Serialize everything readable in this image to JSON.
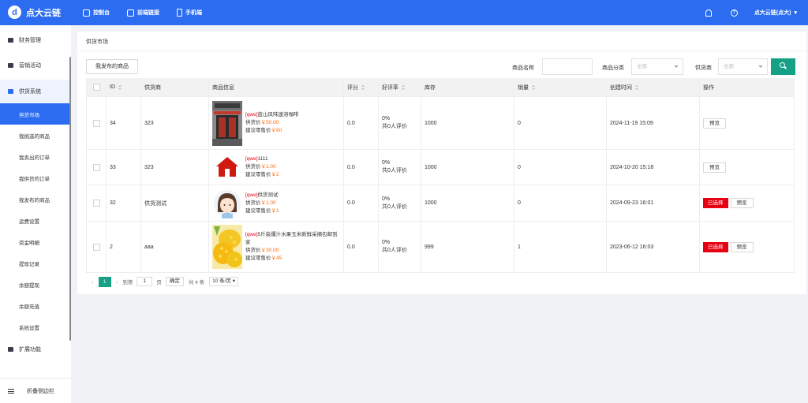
{
  "app": {
    "name": "点大云链",
    "logo_letter": "d"
  },
  "topnav": [
    {
      "label": "控制台",
      "icon": "dashboard-icon"
    },
    {
      "label": "前端链接",
      "icon": "edit-icon"
    },
    {
      "label": "手机端",
      "icon": "phone-icon"
    }
  ],
  "header": {
    "help_glyph": "?",
    "user": "点大云链(点大)",
    "caret": "▾"
  },
  "sidebar": {
    "items": [
      {
        "label": "财务管理",
        "type": "group"
      },
      {
        "label": "营销活动",
        "type": "group"
      },
      {
        "label": "供货系统",
        "type": "group"
      },
      {
        "label": "供货市场",
        "type": "sub"
      },
      {
        "label": "我挑选的商品",
        "type": "sub"
      },
      {
        "label": "我卖出的订单",
        "type": "sub"
      },
      {
        "label": "我供货的订单",
        "type": "sub"
      },
      {
        "label": "我发布的商品",
        "type": "sub"
      },
      {
        "label": "运费设置",
        "type": "sub"
      },
      {
        "label": "资金明细",
        "type": "sub"
      },
      {
        "label": "提现记录",
        "type": "sub"
      },
      {
        "label": "余额提现",
        "type": "sub"
      },
      {
        "label": "余额充值",
        "type": "sub"
      },
      {
        "label": "系统设置",
        "type": "sub"
      },
      {
        "label": "扩展功能",
        "type": "group"
      }
    ],
    "fold_label": "折叠侧边栏"
  },
  "page": {
    "title": "供货市场",
    "my_published_button": "我发布的商品",
    "filters": {
      "name_label": "商品名称",
      "name_value": "",
      "category_label": "商品分类",
      "category_value": "全部",
      "supplier_label": "供货商",
      "supplier_value": "全部"
    }
  },
  "table": {
    "headers": [
      "ID",
      "供货商",
      "商品信息",
      "评分",
      "好评率",
      "库存",
      "销量",
      "创建时间",
      "操作"
    ],
    "rows": [
      {
        "id": "34",
        "supplier": "323",
        "tag": "[qwe]",
        "name": "蓝山风味速溶咖啡",
        "supply_label": "供货价",
        "supply_price": "￥50.00",
        "retail_label": "建议零售价",
        "retail_price": "￥60",
        "score": "0.0",
        "rate": "0%",
        "reviews": "共0人评价",
        "stock": "1000",
        "sales": "0",
        "created": "2024-11-19 15:09",
        "selected_label": "",
        "preview_label": "预览",
        "thumb": "shop-front-image"
      },
      {
        "id": "33",
        "supplier": "323",
        "tag": "[qwe]",
        "name": "1111",
        "supply_label": "供货价",
        "supply_price": "￥1.00",
        "retail_label": "建议零售价",
        "retail_price": "￥2",
        "score": "0.0",
        "rate": "0%",
        "reviews": "共0人评价",
        "stock": "1000",
        "sales": "0",
        "created": "2024-10-20 15:18",
        "selected_label": "",
        "preview_label": "预览",
        "thumb": "house-icon"
      },
      {
        "id": "32",
        "supplier": "供货测试",
        "tag": "[qwe]",
        "name": "供货测试",
        "supply_label": "供货价",
        "supply_price": "￥1.00",
        "retail_label": "建议零售价",
        "retail_price": "￥1",
        "score": "0.0",
        "rate": "0%",
        "reviews": "共0人评价",
        "stock": "1000",
        "sales": "0",
        "created": "2024-09-23 16:01",
        "selected_label": "已选择",
        "preview_label": "预览",
        "thumb": "girl-avatar-image"
      },
      {
        "id": "2",
        "supplier": "aaa",
        "tag": "[qwe]",
        "name": "5斤装爆汁水果玉米新鲜采摘包邮到家",
        "supply_label": "供货价",
        "supply_price": "￥30.00",
        "retail_label": "建议零售价",
        "retail_price": "￥45",
        "score": "0.0",
        "rate": "0%",
        "reviews": "共0人评价",
        "stock": "999",
        "sales": "1",
        "created": "2023-06-12 16:03",
        "selected_label": "已选择",
        "preview_label": "预览",
        "thumb": "corn-image"
      }
    ]
  },
  "pager": {
    "prev": "‹",
    "next": "›",
    "current": "1",
    "goto_prefix": "到第",
    "goto_value": "1",
    "goto_suffix": "页",
    "confirm": "确定",
    "total": "共 4 条",
    "per_page": "10 条/页 ▾"
  },
  "colors": {
    "primary": "#2b6cf0",
    "accent": "#16a085",
    "danger": "#e60012",
    "price": "#ff6a00"
  }
}
